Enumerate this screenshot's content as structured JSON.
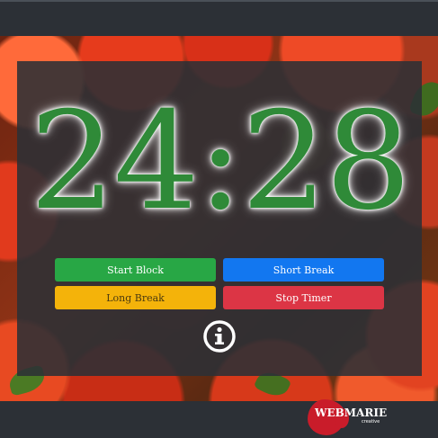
{
  "timer": {
    "display": "24:28"
  },
  "controls": {
    "start_label": "Start Block",
    "short_label": "Short Break",
    "long_label": "Long Break",
    "stop_label": "Stop Timer"
  },
  "colors": {
    "start": "#28a745",
    "short": "#1277f0",
    "long": "#f4b30a",
    "stop": "#dc3545",
    "timer_digits": "#2f8a38",
    "logo": "#c91c2a"
  },
  "icons": {
    "info": "info-circle-icon"
  },
  "brand": {
    "name": "WEBMARIE",
    "tagline": "creative"
  }
}
